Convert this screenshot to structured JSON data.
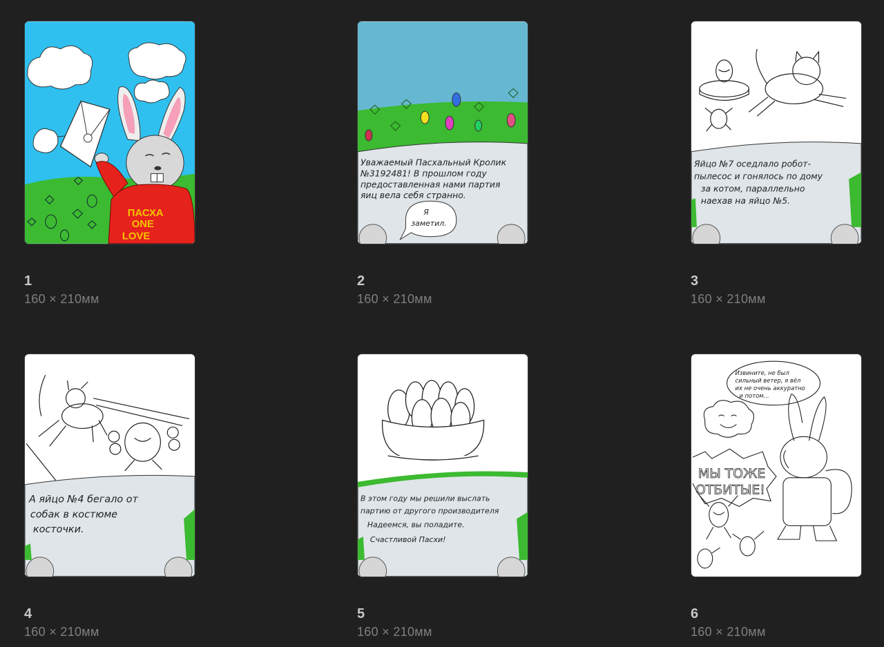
{
  "pages": [
    {
      "number": "1",
      "size": "160 × 210мм",
      "art": {
        "hoodie_text": [
          "ПАСХА",
          "ONE",
          "LOVE"
        ]
      }
    },
    {
      "number": "2",
      "size": "160 × 210мм",
      "art": {
        "caption": [
          "Уважаемый Пасхальный Кролик",
          "№3192481! В прошлом году",
          "предоставленная нами партия",
          "яиц вела себя странно."
        ],
        "bubble": [
          "Я",
          "заметил."
        ]
      }
    },
    {
      "number": "3",
      "size": "160 × 210мм",
      "art": {
        "caption": [
          "Яйцо №7 оседлало робот-",
          "пылесос и гонялось по дому",
          "за котом, параллельно",
          "наехав на яйцо №5."
        ]
      }
    },
    {
      "number": "4",
      "size": "160 × 210мм",
      "art": {
        "caption": [
          "А яйцо №4 бегало от",
          "собак в костюме",
          "косточки."
        ]
      }
    },
    {
      "number": "5",
      "size": "160 × 210мм",
      "art": {
        "caption": [
          "В этом году мы решили выслать",
          "партию от другого производителя",
          "Надеемся, вы поладите.",
          "Счастливой Пасхи!"
        ]
      }
    },
    {
      "number": "6",
      "size": "160 × 210мм",
      "art": {
        "bubble": [
          "Извините, не был",
          "сильный ветер, я вёл",
          "их не очень аккуратно",
          "и потом..."
        ],
        "shout": [
          "МЫ ТОЖЕ",
          "ОТБИТЫЕ!"
        ]
      }
    }
  ],
  "colors": {
    "background": "#202020",
    "sky": "#2fc0ef",
    "sky_page2": "#66b8d2",
    "grass": "#3cba31",
    "hoodie": "#e5221b",
    "hoodie_text": "#f5c400",
    "caption_panel": "#dfe5e8"
  }
}
